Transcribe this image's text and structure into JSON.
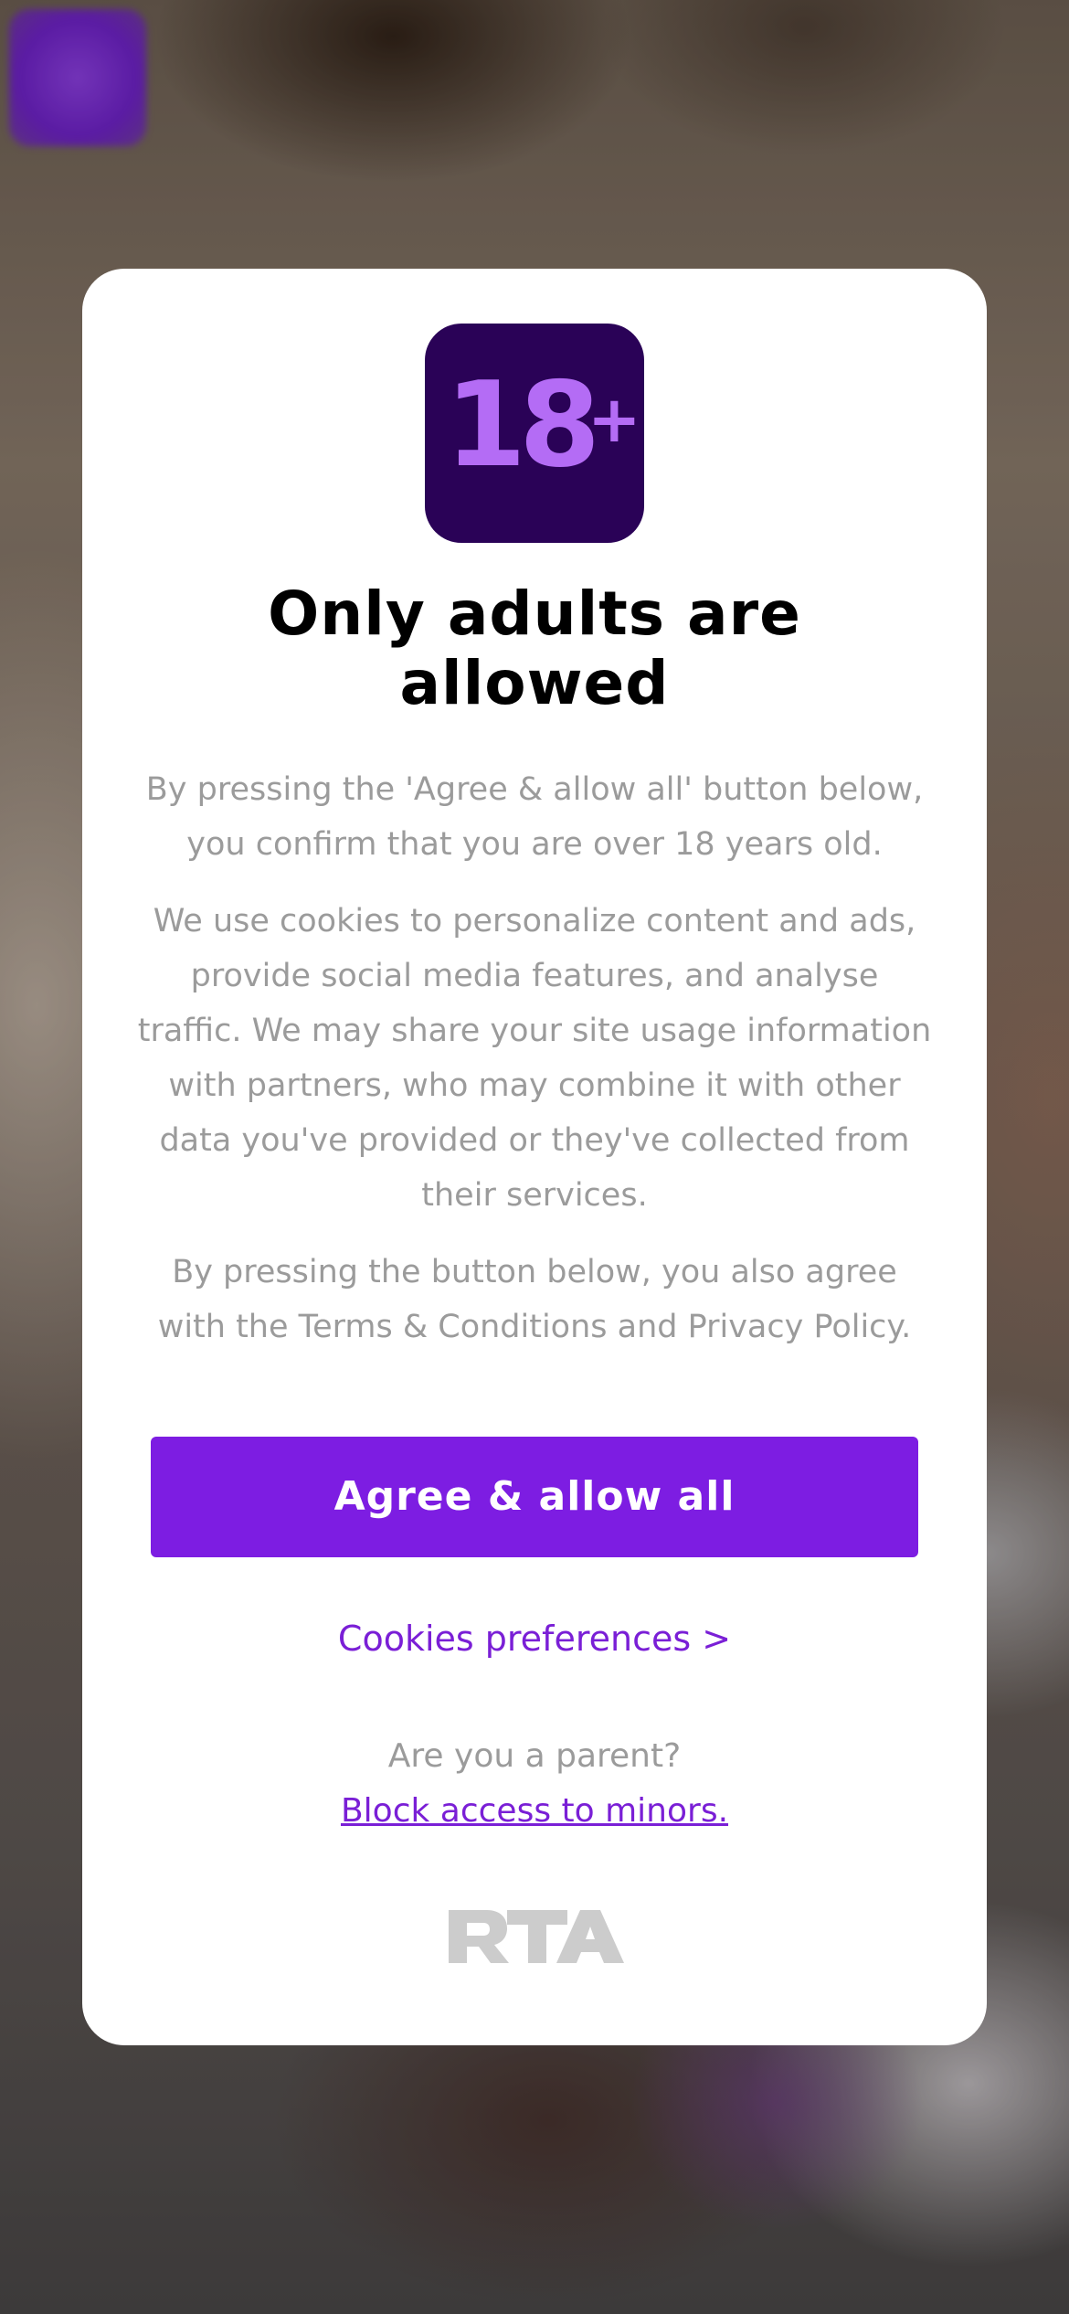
{
  "modal": {
    "badge": {
      "number": "18",
      "plus": "+",
      "background_color": "#2a0257",
      "text_color": "#b46cf5"
    },
    "title": "Only adults are allowed",
    "paragraphs": [
      "By pressing the 'Agree & allow all' button below, you confirm that you are over 18 years old.",
      "We use cookies to personalize content and ads, provide social media features, and analyse traffic. We may share your site usage information with partners, who may combine it with other data you've provided or they've collected from their services.",
      "By pressing the button below, you also agree with the Terms & Conditions and Privacy Policy."
    ],
    "agree_button_label": "Agree & allow all",
    "cookies_link_label": "Cookies preferences >",
    "parent_question": "Are you a parent?",
    "block_link_label": "Block access to minors.",
    "logo": {
      "text": "RTA",
      "icon": "rta-logo",
      "color": "#cccccc"
    }
  },
  "colors": {
    "accent": "#7d1de2",
    "link": "#7a1fd6",
    "muted_text": "#9b9b9b",
    "title_text": "#000000"
  }
}
